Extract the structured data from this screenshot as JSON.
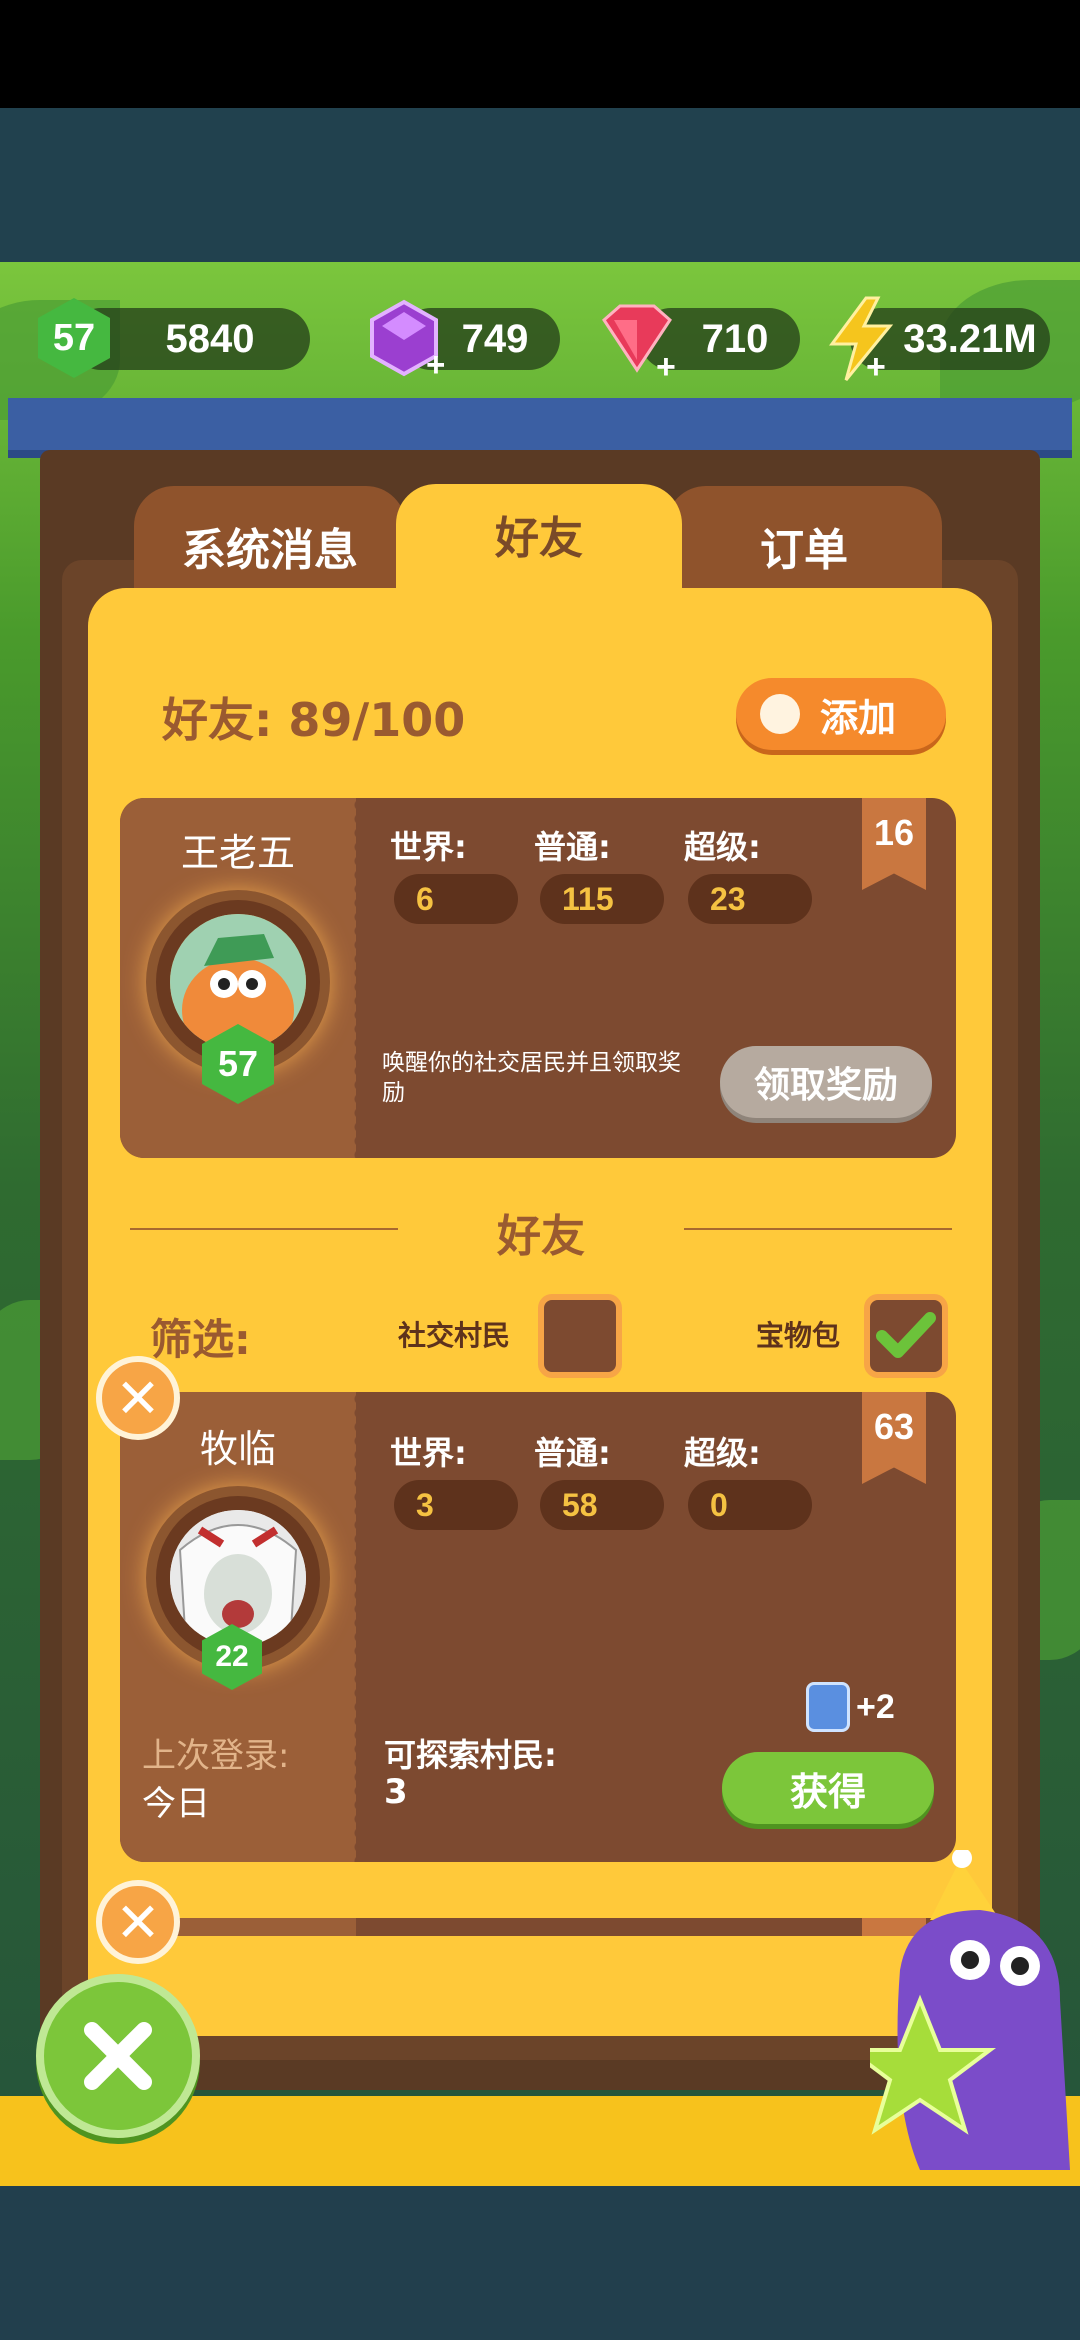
{
  "resources": {
    "level": "57",
    "xp": "5840",
    "purple_gems": "749",
    "red_gems": "710",
    "energy": "33.21M"
  },
  "tabs": [
    {
      "label": "系统消息",
      "active": false
    },
    {
      "label": "好友",
      "active": true
    },
    {
      "label": "订单",
      "active": false
    }
  ],
  "friends_header": {
    "label": "好友: 89/100",
    "add_label": "添加"
  },
  "featured_friend": {
    "name": "王老五",
    "level": "57",
    "rank": "16",
    "world_label": "世界:",
    "world_value": "6",
    "normal_label": "普通:",
    "normal_value": "115",
    "super_label": "超级:",
    "super_value": "23",
    "message": "唤醒你的社交居民并且领取奖励",
    "reward_button": "领取奖励"
  },
  "section_title": "好友",
  "filter": {
    "label": "筛选:",
    "social_villager_label": "社交村民",
    "social_villager_checked": false,
    "treasure_label": "宝物包",
    "treasure_checked": true
  },
  "friend_card": {
    "name": "牧临",
    "level": "22",
    "rank": "63",
    "world_label": "世界:",
    "world_value": "3",
    "normal_label": "普通:",
    "normal_value": "58",
    "super_label": "超级:",
    "super_value": "0",
    "last_login_label": "上次登录:",
    "last_login_value": "今日",
    "explorable_label": "可探索村民:",
    "explorable_value": "3",
    "bonus": "+2",
    "get_button": "获得"
  },
  "colors": {
    "panel": "#ffc93a",
    "card": "#7d4a30",
    "green_button": "#7cc63a",
    "accent_orange": "#f7a546"
  }
}
